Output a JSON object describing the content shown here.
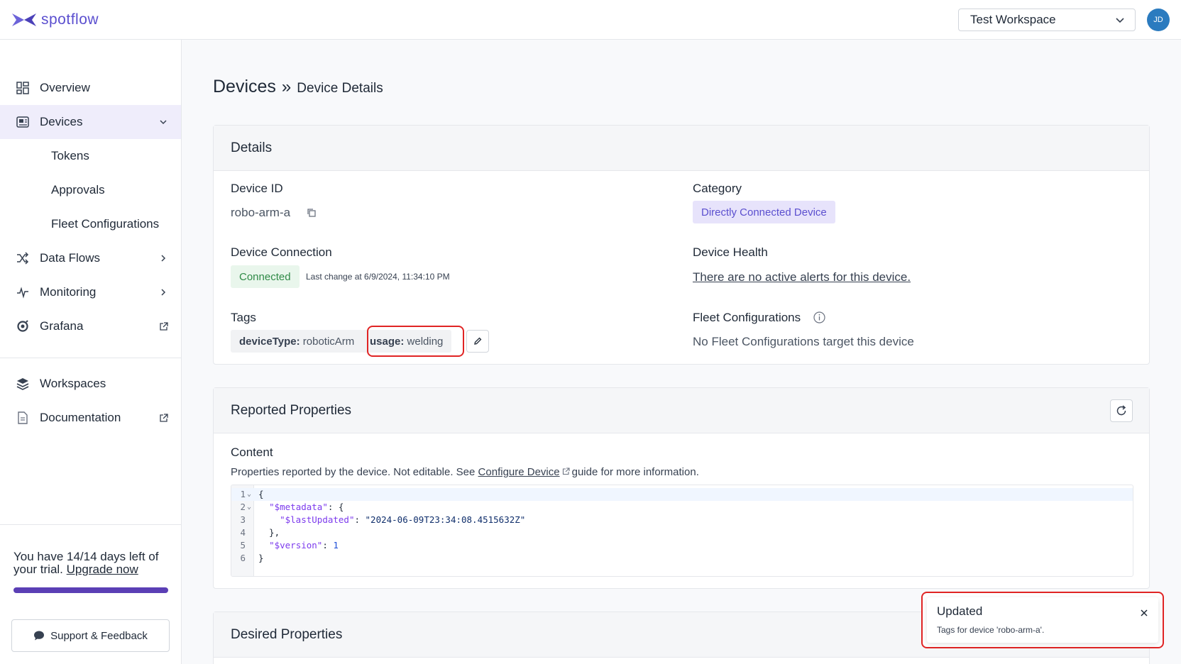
{
  "app": {
    "brand": "spotflow",
    "accent": "#5b4fcf"
  },
  "header": {
    "workspace": "Test Workspace",
    "avatar_initials": "JD"
  },
  "sidebar": {
    "items": [
      {
        "label": "Overview",
        "icon": "grid-icon"
      },
      {
        "label": "Devices",
        "icon": "device-icon",
        "expanded": true,
        "active": true
      },
      {
        "label": "Tokens"
      },
      {
        "label": "Approvals"
      },
      {
        "label": "Fleet Configurations"
      },
      {
        "label": "Data Flows",
        "icon": "shuffle-icon"
      },
      {
        "label": "Monitoring",
        "icon": "pulse-icon"
      },
      {
        "label": "Grafana",
        "icon": "grafana-icon",
        "external": true
      },
      {
        "label": "Workspaces",
        "icon": "layers-icon"
      },
      {
        "label": "Documentation",
        "icon": "document-icon",
        "external": true
      }
    ],
    "trial_text": "You have 14/14 days left of your trial.",
    "upgrade_link": "Upgrade now",
    "trial_progress": 1.0,
    "support_label": "Support & Feedback"
  },
  "breadcrumb": {
    "main": "Devices",
    "sep": "»",
    "sub": "Device Details"
  },
  "details": {
    "title": "Details",
    "device_id_label": "Device ID",
    "device_id": "robo-arm-a",
    "category_label": "Category",
    "category": "Directly Connected Device",
    "connection_label": "Device Connection",
    "connection_status": "Connected",
    "last_change": "Last change at 6/9/2024, 11:34:10 PM",
    "health_label": "Device Health",
    "health_text": "There are no active alerts for this device.",
    "tags_label": "Tags",
    "tags": [
      {
        "key": "deviceType:",
        "value": "roboticArm"
      },
      {
        "key": "usage:",
        "value": "welding"
      }
    ],
    "fleet_label": "Fleet Configurations",
    "fleet_text": "No Fleet Configurations target this device"
  },
  "reported": {
    "title": "Reported Properties",
    "content_label": "Content",
    "desc_before": "Properties reported by the device. Not editable. See",
    "desc_link": "Configure Device",
    "desc_after": "guide for more information.",
    "code_lines": [
      "1",
      "2",
      "3",
      "4",
      "5",
      "6"
    ]
  },
  "desired": {
    "title": "Desired Properties"
  },
  "toast": {
    "title": "Updated",
    "body": "Tags for device 'robo-arm-a'."
  }
}
